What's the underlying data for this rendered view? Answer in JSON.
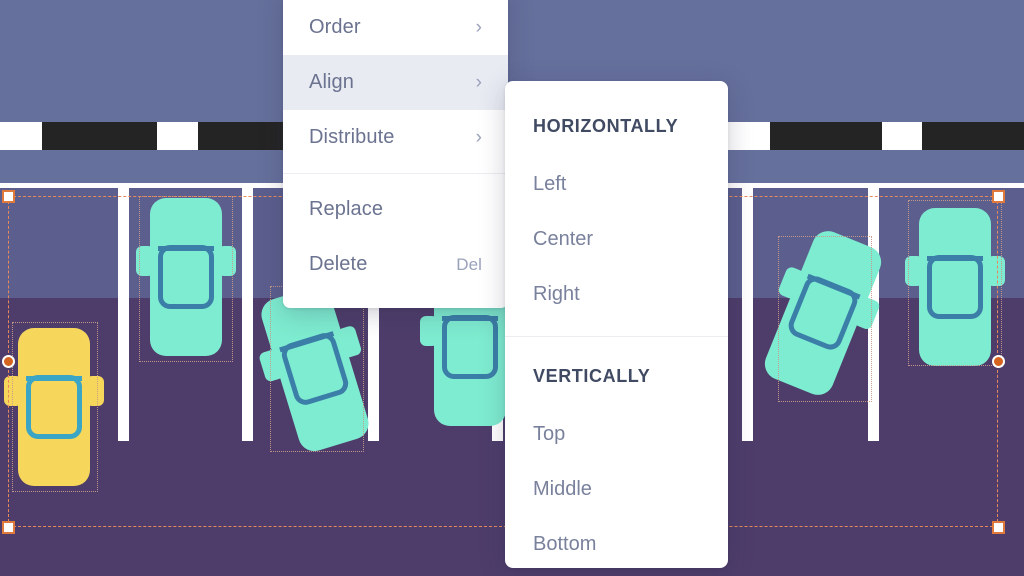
{
  "app": {
    "type": "vector-design-editor",
    "canvas_title": "parking-lot-illustration"
  },
  "colors": {
    "road": "#65709c",
    "crosswalk_block": "#242424",
    "crosswalk_gap": "#ffffff",
    "lot_asphalt": "#4e3d6b",
    "stall_top": "#5c5f8e",
    "stall_line": "#ffffff",
    "car_teal": "#7eecd0",
    "car_yellow": "#f6d65b",
    "car_window_teal": "#3b7fa8",
    "car_window_yellow": "#3aa5c4",
    "selection_stroke": "#e0865a",
    "handle_fill": "#ffffff",
    "handle_stroke": "#e07a3c",
    "handle_round_fill": "#d4641f",
    "menu_bg": "#ffffff",
    "menu_text": "#6b7390",
    "menu_highlight": "#e8ebf2",
    "menu_divider": "#ececf1",
    "submenu_heading": "#404a63",
    "submenu_text": "#79819c"
  },
  "context_menu": {
    "name": "object-context-menu",
    "items": [
      {
        "label": "Order",
        "icon": "chevron-right-icon",
        "has_submenu": true,
        "highlighted": false,
        "shortcut": ""
      },
      {
        "label": "Align",
        "icon": "chevron-right-icon",
        "has_submenu": true,
        "highlighted": true,
        "shortcut": ""
      },
      {
        "label": "Distribute",
        "icon": "chevron-right-icon",
        "has_submenu": true,
        "highlighted": false,
        "shortcut": ""
      },
      {
        "label": "Replace",
        "icon": "",
        "has_submenu": false,
        "highlighted": false,
        "shortcut": ""
      },
      {
        "label": "Delete",
        "icon": "",
        "has_submenu": false,
        "highlighted": false,
        "shortcut": "Del"
      }
    ],
    "divider_after_index": 2,
    "chevron_glyph": "›"
  },
  "align_submenu": {
    "name": "align-submenu",
    "groups": [
      {
        "heading": "HORIZONTALLY",
        "items": [
          {
            "label": "Left"
          },
          {
            "label": "Center"
          },
          {
            "label": "Right"
          }
        ]
      },
      {
        "heading": "VERTICALLY",
        "items": [
          {
            "label": "Top"
          },
          {
            "label": "Middle"
          },
          {
            "label": "Bottom"
          }
        ]
      }
    ]
  },
  "canvas": {
    "selection": {
      "name": "multi-object-selection",
      "handles": [
        {
          "position": "top-left",
          "shape": "square"
        },
        {
          "position": "middle-left",
          "shape": "circle"
        },
        {
          "position": "bottom-left",
          "shape": "square"
        },
        {
          "position": "top-right",
          "shape": "square"
        },
        {
          "position": "middle-right",
          "shape": "circle"
        },
        {
          "position": "bottom-right",
          "shape": "square"
        }
      ]
    },
    "cars": [
      {
        "id": "car-1",
        "color": "yellow",
        "rotation": 0,
        "stall": 1,
        "selected": true
      },
      {
        "id": "car-2",
        "color": "teal",
        "rotation": 0,
        "stall": 2,
        "selected": true
      },
      {
        "id": "car-3",
        "color": "teal",
        "rotation": -17,
        "stall": 3,
        "selected": true
      },
      {
        "id": "car-4",
        "color": "teal",
        "rotation": 0,
        "stall": 4,
        "selected": true
      },
      {
        "id": "car-5",
        "color": "teal",
        "rotation": 22,
        "stall": 6,
        "selected": true
      },
      {
        "id": "car-6",
        "color": "teal",
        "rotation": 0,
        "stall": 7,
        "selected": true
      }
    ],
    "stall_count": 7,
    "crosswalk_block_count": 5
  }
}
